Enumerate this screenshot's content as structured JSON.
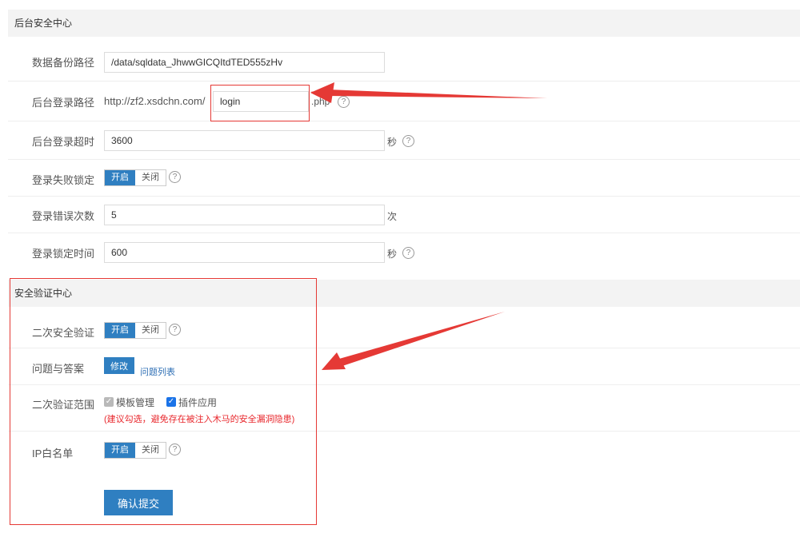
{
  "backend_security": {
    "header": "后台安全中心",
    "backup_path": {
      "label": "数据备份路径",
      "value": "/data/sqldata_JhwwGICQItdTED555zHv"
    },
    "login_path": {
      "label": "后台登录路径",
      "prefix": "http://zf2.xsdchn.com/",
      "value": "login",
      "suffix": ".php"
    },
    "login_timeout": {
      "label": "后台登录超时",
      "value": "3600",
      "unit": "秒"
    },
    "fail_lock": {
      "label": "登录失败锁定",
      "on": "开启",
      "off": "关闭"
    },
    "error_count": {
      "label": "登录错误次数",
      "value": "5",
      "unit": "次"
    },
    "lock_time": {
      "label": "登录锁定时间",
      "value": "600",
      "unit": "秒"
    },
    "help_glyph": "?"
  },
  "verify_center": {
    "header": "安全验证中心",
    "second_verify": {
      "label": "二次安全验证",
      "on": "开启",
      "off": "关闭"
    },
    "qa": {
      "label": "问题与答案",
      "edit_button": "修改",
      "list_link": "问题列表"
    },
    "scope": {
      "label": "二次验证范围",
      "options": [
        {
          "label": "模板管理",
          "checked": true,
          "disabled": true
        },
        {
          "label": "插件应用",
          "checked": true,
          "disabled": false
        }
      ],
      "warning": "(建议勾选，避免存在被注入木马的安全漏洞隐患)"
    },
    "ip_whitelist": {
      "label": "IP白名单",
      "on": "开启",
      "off": "关闭"
    },
    "submit": "确认提交"
  },
  "colors": {
    "accent": "#2f7fc1",
    "annotation": "#e53935",
    "warning": "#e8262b"
  }
}
